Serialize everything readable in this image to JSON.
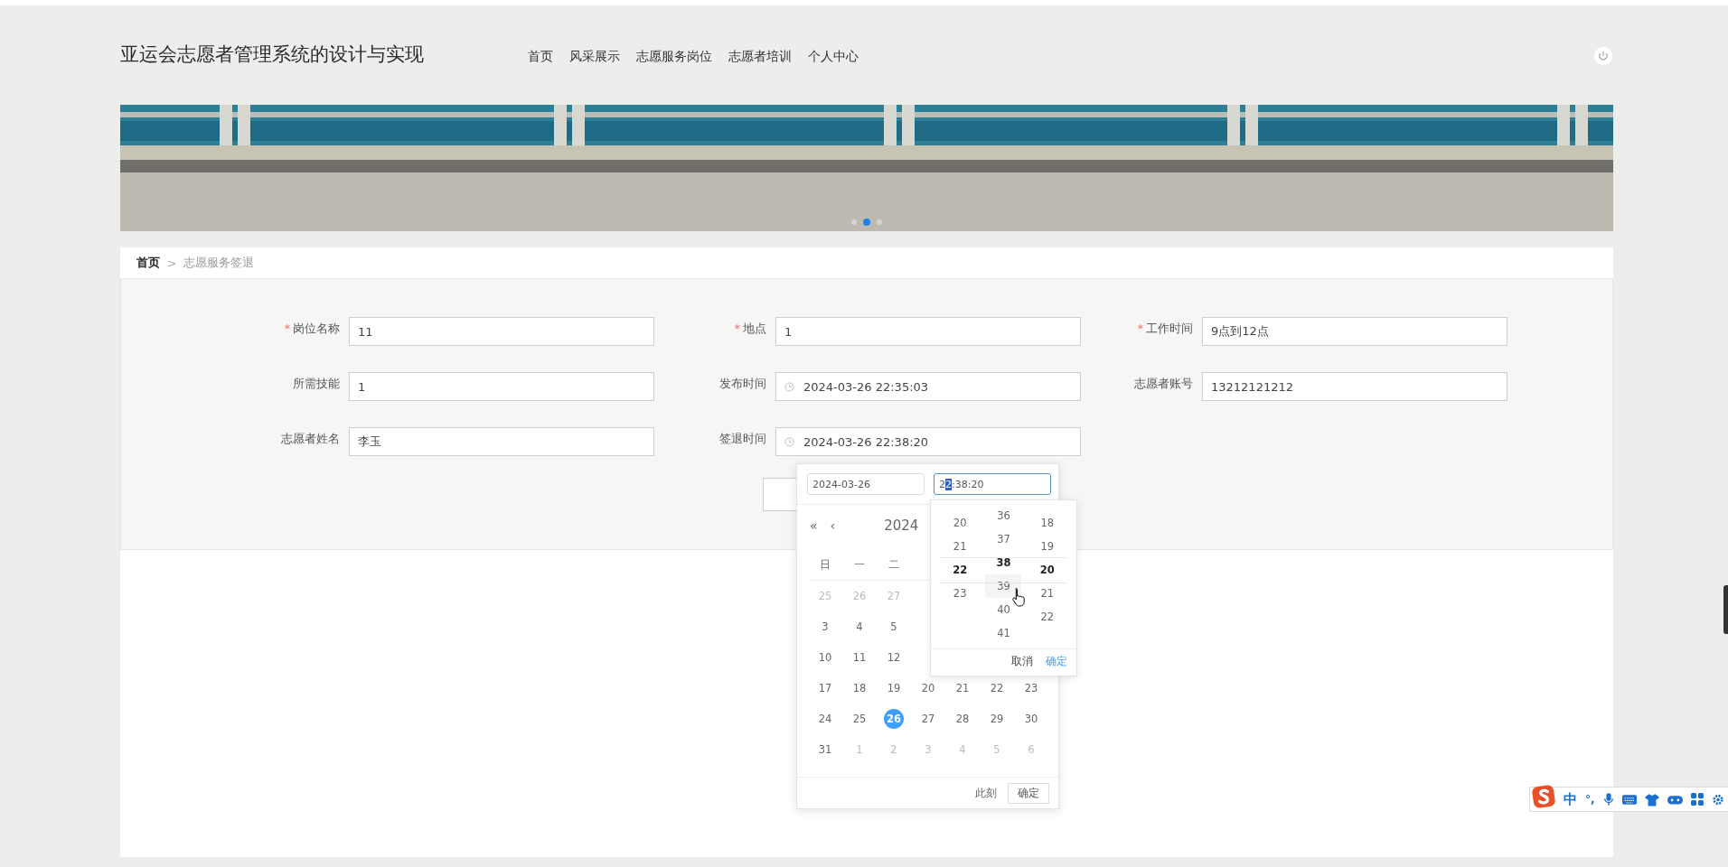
{
  "header": {
    "title": "亚运会志愿者管理系统的设计与实现",
    "nav": [
      {
        "label": "首页"
      },
      {
        "label": "风采展示"
      },
      {
        "label": "志愿服务岗位"
      },
      {
        "label": "志愿者培训"
      },
      {
        "label": "个人中心"
      }
    ]
  },
  "banner": {
    "dots": [
      {
        "selected": false
      },
      {
        "selected": true
      },
      {
        "selected": false
      }
    ]
  },
  "breadcrumb": {
    "items": [
      {
        "label": "首页",
        "current": false
      },
      {
        "label": "志愿服务签退",
        "current": true
      }
    ],
    "separator": ">"
  },
  "form": {
    "fields": [
      {
        "label": "岗位名称",
        "required_mark": "*",
        "kind": "text",
        "value": "11"
      },
      {
        "label": "地点",
        "required_mark": "*",
        "kind": "text",
        "value": "1"
      },
      {
        "label": "工作时间",
        "required_mark": "*",
        "kind": "text",
        "value": "9点到12点"
      },
      {
        "label": "所需技能",
        "kind": "text",
        "value": "1"
      },
      {
        "label": "发布时间",
        "kind": "datetime",
        "value": "2024-03-26 22:35:03"
      },
      {
        "label": "志愿者账号",
        "kind": "text",
        "value": "13212121212"
      },
      {
        "label": "志愿者姓名",
        "kind": "text",
        "value": "李玉"
      },
      {
        "label": "签退时间",
        "kind": "datetime",
        "value": "2024-03-26 22:38:20"
      }
    ]
  },
  "date_picker": {
    "date_input": "2024-03-26",
    "time_input": "22:38:20",
    "prev_year": "«",
    "prev_month": "‹",
    "year": "2024",
    "weekdays": [
      "日",
      "一",
      "二"
    ],
    "weeks": [
      [
        {
          "day": "25",
          "muted": true,
          "selected": false
        },
        {
          "day": "26",
          "muted": true,
          "selected": false
        },
        {
          "day": "27",
          "muted": true,
          "selected": false
        }
      ],
      [
        {
          "day": "3",
          "muted": false,
          "selected": false
        },
        {
          "day": "4",
          "muted": false,
          "selected": false
        },
        {
          "day": "5",
          "muted": false,
          "selected": false
        }
      ],
      [
        {
          "day": "10",
          "muted": false,
          "selected": false
        },
        {
          "day": "11",
          "muted": false,
          "selected": false
        },
        {
          "day": "12",
          "muted": false,
          "selected": false
        }
      ],
      [
        {
          "day": "17",
          "muted": false,
          "selected": false
        },
        {
          "day": "18",
          "muted": false,
          "selected": false
        },
        {
          "day": "19",
          "muted": false,
          "selected": false
        },
        {
          "day": "20",
          "muted": false,
          "selected": false
        },
        {
          "day": "21",
          "muted": false,
          "selected": false
        },
        {
          "day": "22",
          "muted": false,
          "selected": false
        },
        {
          "day": "23",
          "muted": false,
          "selected": false
        }
      ],
      [
        {
          "day": "24",
          "muted": false,
          "selected": false
        },
        {
          "day": "25",
          "muted": false,
          "selected": false
        },
        {
          "day": "26",
          "muted": false,
          "selected": true
        },
        {
          "day": "27",
          "muted": false,
          "selected": false
        },
        {
          "day": "28",
          "muted": false,
          "selected": false
        },
        {
          "day": "29",
          "muted": false,
          "selected": false
        },
        {
          "day": "30",
          "muted": false,
          "selected": false
        }
      ],
      [
        {
          "day": "31",
          "muted": false,
          "selected": false
        },
        {
          "day": "1",
          "muted": true,
          "selected": false
        },
        {
          "day": "2",
          "muted": true,
          "selected": false
        },
        {
          "day": "3",
          "muted": true,
          "selected": false
        },
        {
          "day": "4",
          "muted": true,
          "selected": false
        },
        {
          "day": "5",
          "muted": true,
          "selected": false
        },
        {
          "day": "6",
          "muted": true,
          "selected": false
        }
      ]
    ],
    "now_link": "此刻",
    "ok_button": "确定",
    "time_panel": {
      "columns": [
        {
          "items": [
            {
              "text": "20",
              "selected": false,
              "hovered": false
            },
            {
              "text": "21",
              "selected": false,
              "hovered": false
            },
            {
              "text": "22",
              "selected": true,
              "hovered": false
            },
            {
              "text": "23",
              "selected": false,
              "hovered": false
            }
          ]
        },
        {
          "items": [
            {
              "text": "36",
              "selected": false,
              "hovered": false
            },
            {
              "text": "37",
              "selected": false,
              "hovered": false
            },
            {
              "text": "38",
              "selected": true,
              "hovered": false
            },
            {
              "text": "39",
              "selected": false,
              "hovered": true
            },
            {
              "text": "40",
              "selected": false,
              "hovered": false
            },
            {
              "text": "41",
              "selected": false,
              "hovered": false
            }
          ]
        },
        {
          "items": [
            {
              "text": "18",
              "selected": false,
              "hovered": false
            },
            {
              "text": "19",
              "selected": false,
              "hovered": false
            },
            {
              "text": "20",
              "selected": true,
              "hovered": false
            },
            {
              "text": "21",
              "selected": false,
              "hovered": false
            },
            {
              "text": "22",
              "selected": false,
              "hovered": false
            }
          ]
        }
      ],
      "cancel": "取消",
      "ok": "确定"
    }
  },
  "ime_toolbar": {
    "language": "中",
    "punctuation": "°,"
  }
}
